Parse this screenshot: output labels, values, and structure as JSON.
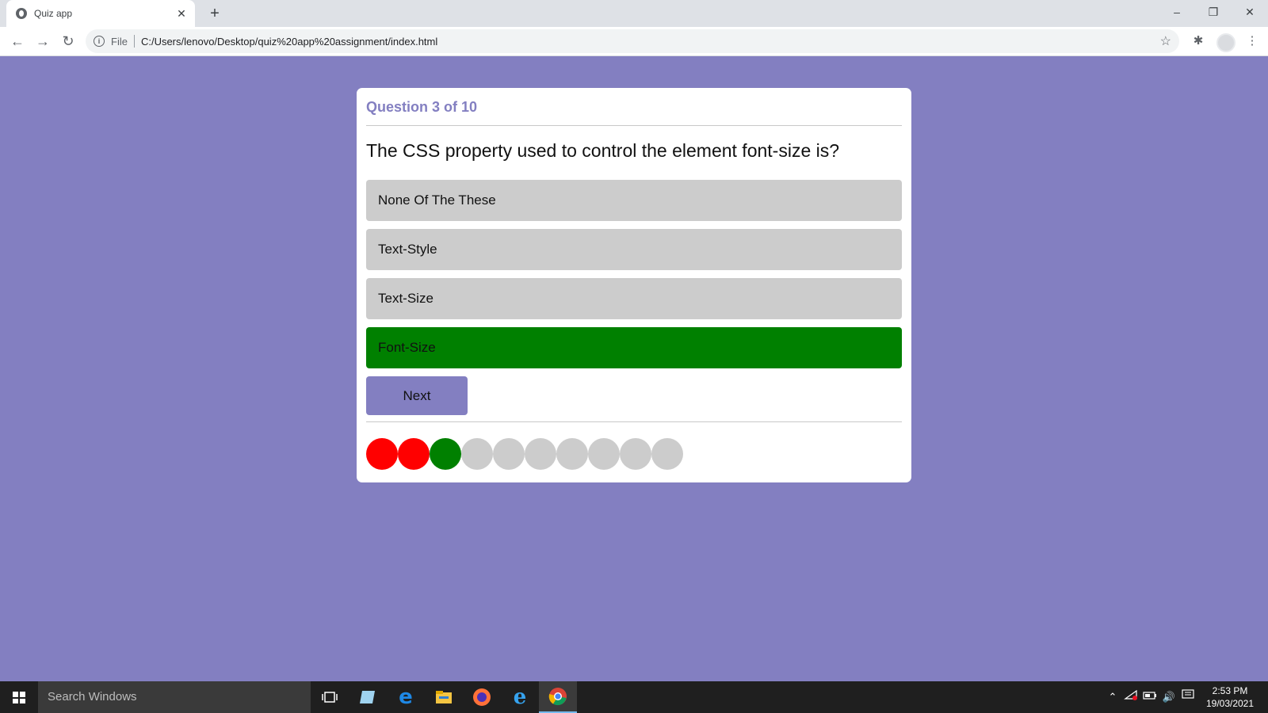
{
  "browser": {
    "tab_title": "Quiz app",
    "tab_close": "✕",
    "new_tab": "+",
    "file_label": "File",
    "url": "C:/Users/lenovo/Desktop/quiz%20app%20assignment/index.html"
  },
  "quiz": {
    "counter": "Question 3 of 10",
    "question": "The CSS property used to control the element font-size is?",
    "options": [
      {
        "label": "None Of The These",
        "state": "neutral"
      },
      {
        "label": "Text-Style",
        "state": "neutral"
      },
      {
        "label": "Text-Size",
        "state": "neutral"
      },
      {
        "label": "Font-Size",
        "state": "correct"
      }
    ],
    "next_label": "Next",
    "progress": [
      "wrong",
      "wrong",
      "correct",
      "pending",
      "pending",
      "pending",
      "pending",
      "pending",
      "pending",
      "pending"
    ],
    "colors": {
      "accent": "#837fc1",
      "correct": "#008000",
      "wrong": "#ff0000",
      "pending": "#cccccc"
    }
  },
  "taskbar": {
    "search_placeholder": "Search Windows",
    "time": "2:53 PM",
    "date": "19/03/2021"
  }
}
